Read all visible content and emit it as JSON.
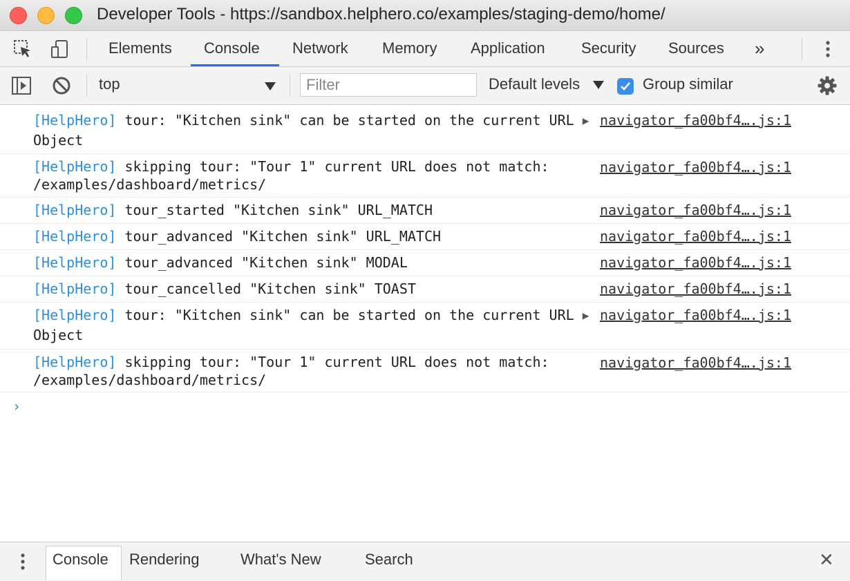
{
  "window": {
    "title": "Developer Tools - https://sandbox.helphero.co/examples/staging-demo/home/"
  },
  "tabs": [
    {
      "label": "Elements"
    },
    {
      "label": "Console"
    },
    {
      "label": "Network"
    },
    {
      "label": "Memory"
    },
    {
      "label": "Application"
    },
    {
      "label": "Security"
    },
    {
      "label": "Sources"
    }
  ],
  "tabs_overflow": "»",
  "toolbar": {
    "context": "top",
    "filter_placeholder": "Filter",
    "levels": "Default levels",
    "group_similar": "Group similar",
    "group_similar_checked": true
  },
  "messages": [
    {
      "tag": "[HelpHero]",
      "text": " tour: \"Kitchen sink\" can be started on the current URL ",
      "object": "Object",
      "source": "navigator_fa00bf4….js:1"
    },
    {
      "tag": "[HelpHero]",
      "text": " skipping tour: \"Tour 1\" current URL does not match: /examples/dashboard/metrics/",
      "object": "",
      "source": "navigator_fa00bf4….js:1"
    },
    {
      "tag": "[HelpHero]",
      "text": " tour_started \"Kitchen sink\" URL_MATCH",
      "object": "",
      "source": "navigator_fa00bf4….js:1"
    },
    {
      "tag": "[HelpHero]",
      "text": " tour_advanced \"Kitchen sink\" URL_MATCH",
      "object": "",
      "source": "navigator_fa00bf4….js:1"
    },
    {
      "tag": "[HelpHero]",
      "text": " tour_advanced \"Kitchen sink\" MODAL",
      "object": "",
      "source": "navigator_fa00bf4….js:1"
    },
    {
      "tag": "[HelpHero]",
      "text": " tour_cancelled \"Kitchen sink\" TOAST",
      "object": "",
      "source": "navigator_fa00bf4….js:1"
    },
    {
      "tag": "[HelpHero]",
      "text": " tour: \"Kitchen sink\" can be started on the current URL ",
      "object": "Object",
      "source": "navigator_fa00bf4….js:1"
    },
    {
      "tag": "[HelpHero]",
      "text": " skipping tour: \"Tour 1\" current URL does not match: /examples/dashboard/metrics/",
      "object": "",
      "source": "navigator_fa00bf4….js:1"
    }
  ],
  "prompt_symbol": "›",
  "drawer": {
    "tabs": [
      {
        "label": "Console"
      },
      {
        "label": "Rendering"
      },
      {
        "label": "What's New"
      },
      {
        "label": "Search"
      }
    ],
    "close_symbol": "✕"
  },
  "icons": {
    "inspect": "inspect-element-icon",
    "device": "device-toolbar-icon",
    "sidebar": "show-sidebar-icon",
    "clear": "clear-console-icon",
    "settings": "gear-icon",
    "menu": "kebab-menu-icon"
  },
  "colors": {
    "accent": "#1a73e8",
    "tag": "#2e8fdc"
  }
}
